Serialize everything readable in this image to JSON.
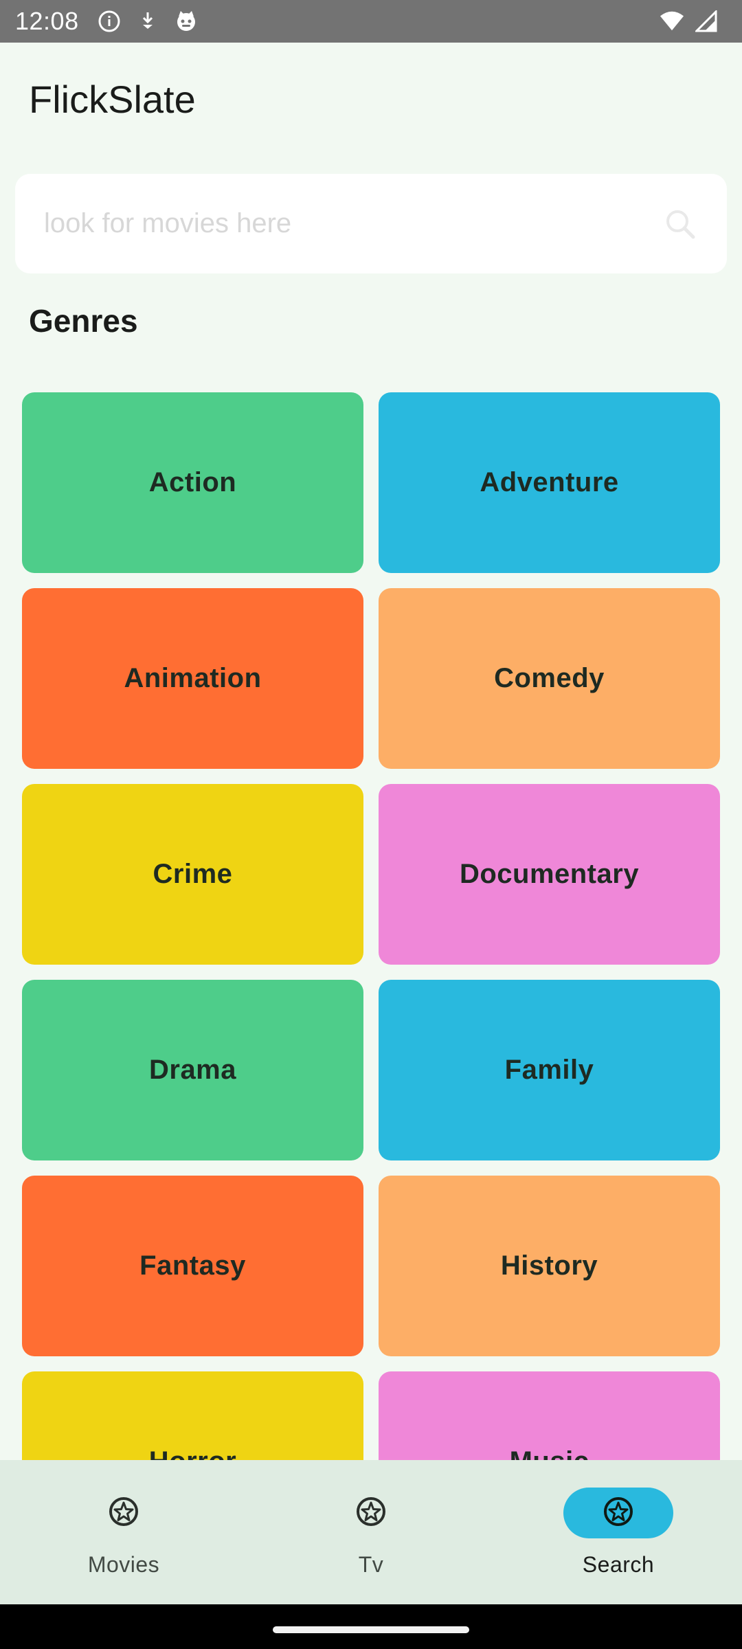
{
  "status_bar": {
    "time": "12:08",
    "left_icons": [
      "info-icon",
      "download-icon",
      "cat-face-icon"
    ],
    "right_icons": [
      "wifi-icon",
      "signal-icon"
    ]
  },
  "app": {
    "title": "FlickSlate"
  },
  "search": {
    "placeholder": "look for movies here",
    "value": ""
  },
  "genres": {
    "heading": "Genres",
    "items": [
      {
        "label": "Action",
        "color": "#4ECD8A"
      },
      {
        "label": "Adventure",
        "color": "#29B9DE"
      },
      {
        "label": "Animation",
        "color": "#FF6E33"
      },
      {
        "label": "Comedy",
        "color": "#FDAE66"
      },
      {
        "label": "Crime",
        "color": "#EFD413"
      },
      {
        "label": "Documentary",
        "color": "#EF87D8"
      },
      {
        "label": "Drama",
        "color": "#4ECD8A"
      },
      {
        "label": "Family",
        "color": "#29B9DE"
      },
      {
        "label": "Fantasy",
        "color": "#FF6E33"
      },
      {
        "label": "History",
        "color": "#FDAE66"
      },
      {
        "label": "Horror",
        "color": "#EFD413"
      },
      {
        "label": "Music",
        "color": "#EF87D8"
      }
    ]
  },
  "bottom_nav": {
    "items": [
      {
        "label": "Movies",
        "icon": "star-circle-icon",
        "active": false
      },
      {
        "label": "Tv",
        "icon": "star-circle-icon",
        "active": false
      },
      {
        "label": "Search",
        "icon": "star-circle-icon",
        "active": true
      }
    ],
    "active_color": "#29B9DE"
  }
}
